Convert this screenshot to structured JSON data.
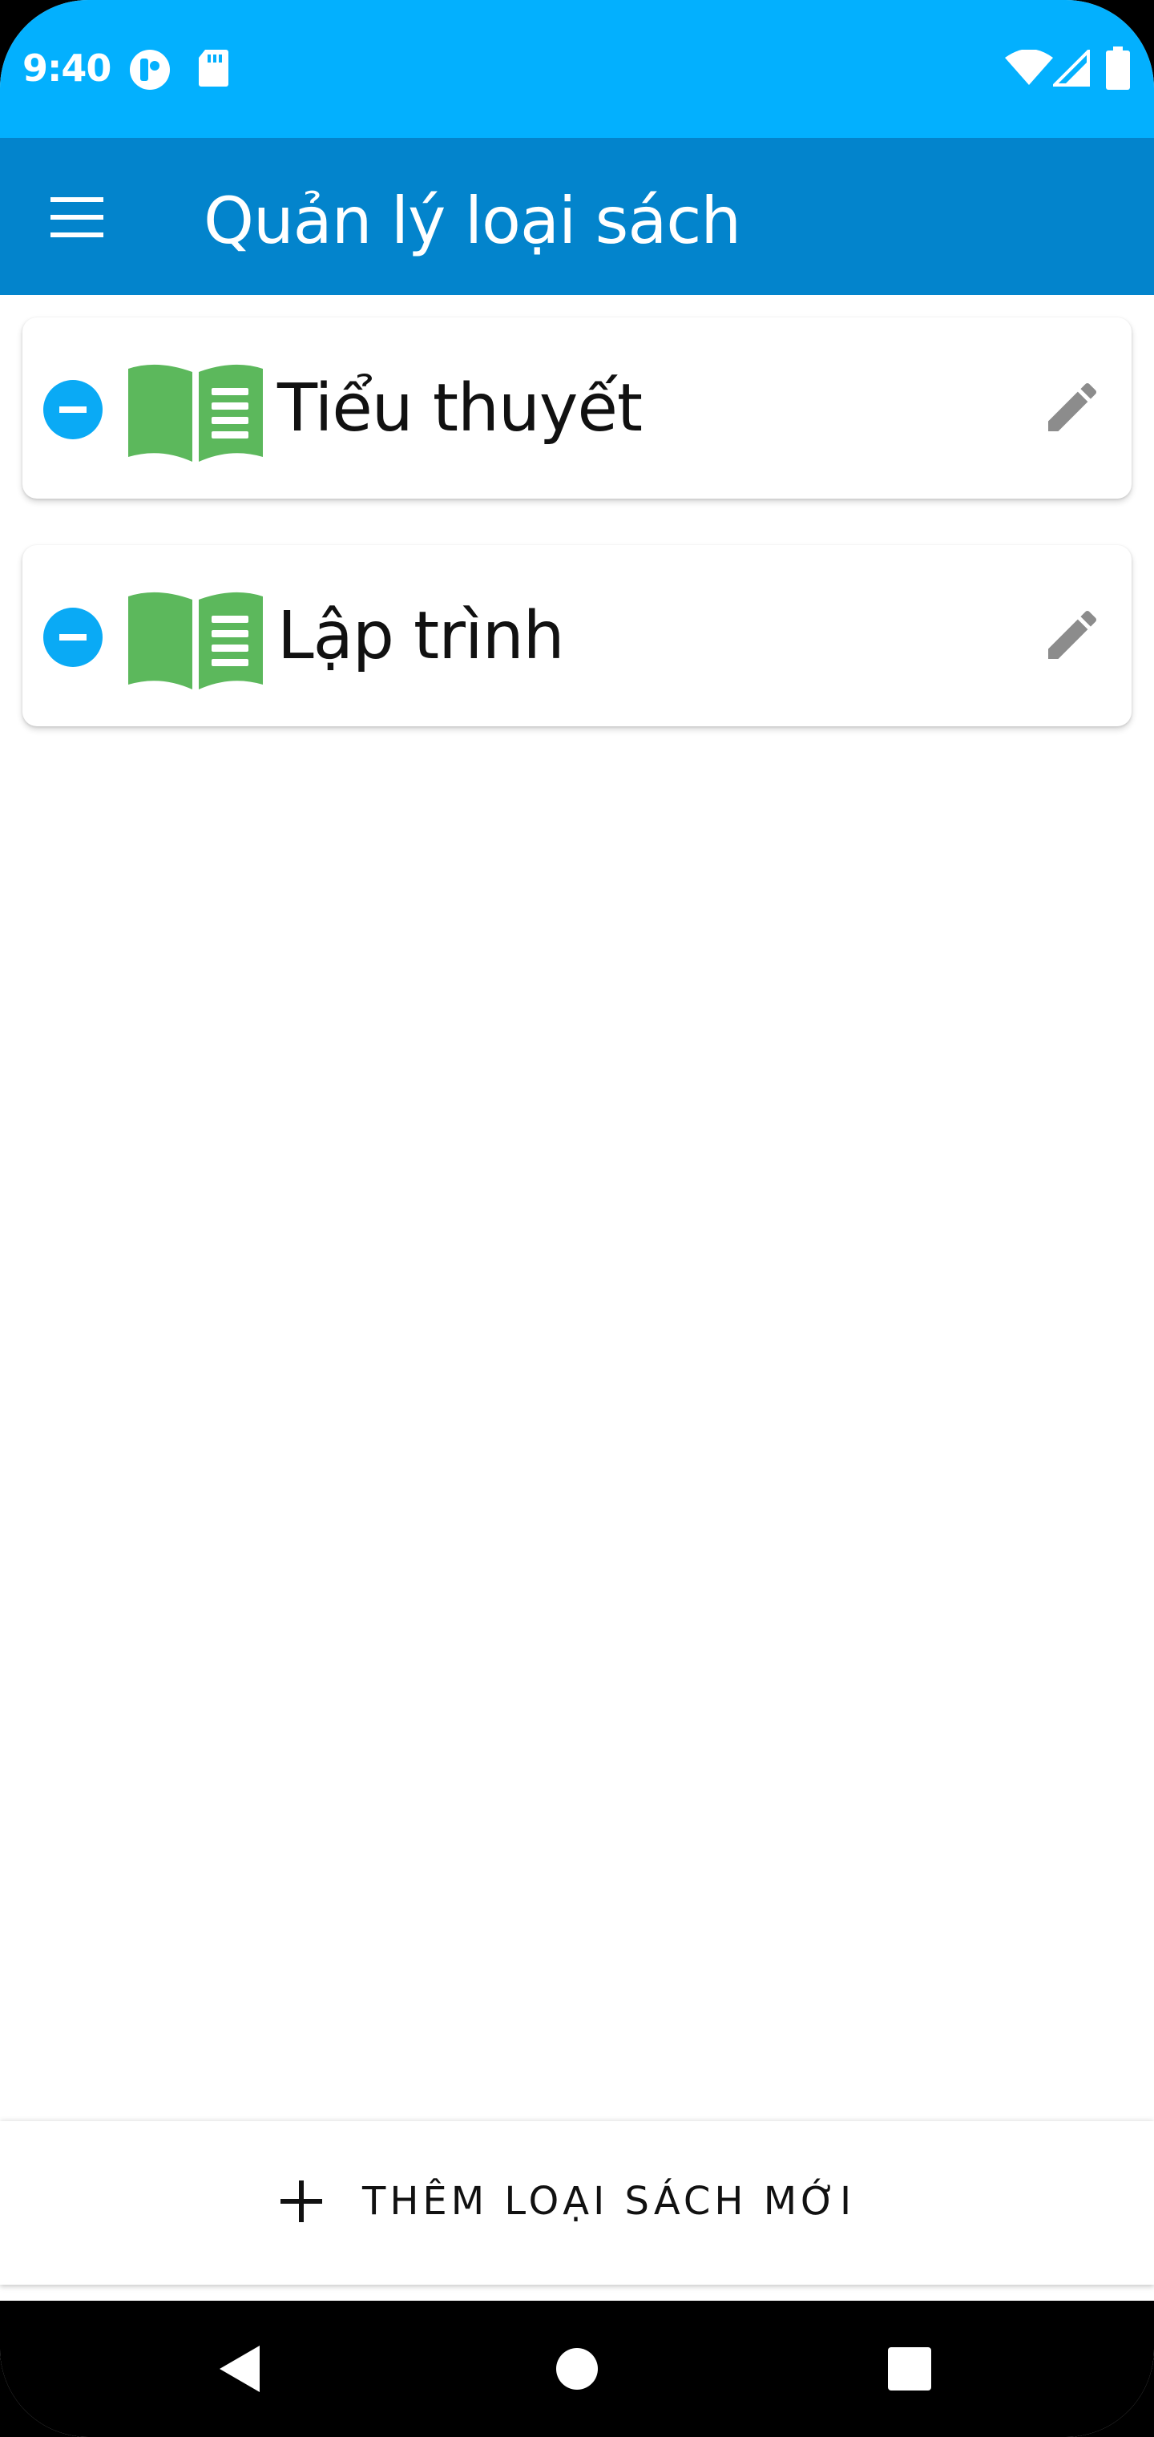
{
  "status_bar": {
    "time": "9:40",
    "left_icons": [
      "app-notification-icon",
      "sd-card-icon"
    ],
    "right_icons": [
      "wifi-icon",
      "signal-icon",
      "battery-icon"
    ]
  },
  "app_bar": {
    "menu_icon": "menu-icon",
    "title": "Quản lý loại sách"
  },
  "categories": [
    {
      "label": "Tiểu thuyết",
      "icon": "book-open-icon"
    },
    {
      "label": "Lập trình",
      "icon": "book-open-icon"
    }
  ],
  "add_button": {
    "icon": "plus-icon",
    "label": "THÊM LOẠI SÁCH MỚI"
  },
  "nav_bar": {
    "icons": [
      "back-icon",
      "home-icon",
      "recents-icon"
    ]
  },
  "colors": {
    "status_bar": "#03b0fe",
    "app_bar": "#0384cc",
    "remove_accent": "#0aaaf5",
    "book_green": "#5cb85c",
    "edit_gray": "#8c8c8c"
  }
}
